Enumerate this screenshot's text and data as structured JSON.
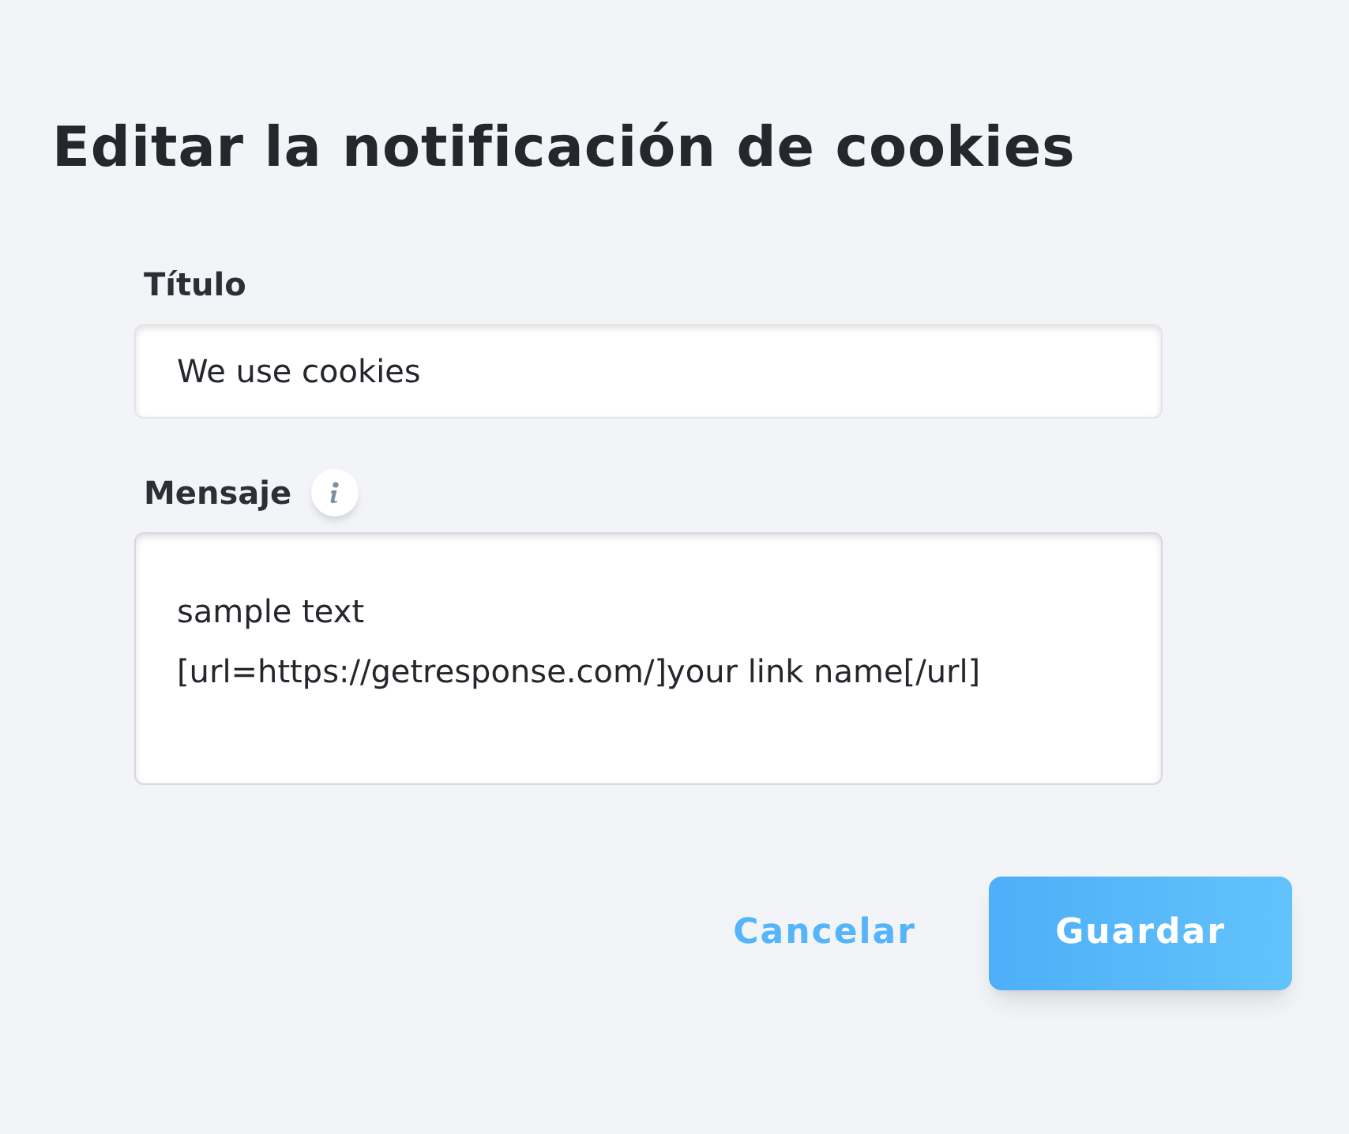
{
  "heading": "Editar la notificación de cookies",
  "fields": [
    {
      "kind": "input",
      "label": "Título",
      "value": "We use cookies",
      "info": false
    },
    {
      "kind": "textarea",
      "label": "Mensaje",
      "value": "sample text\n[url=https://getresponse.com/]your link name[/url]",
      "info": true
    }
  ],
  "buttons": [
    {
      "kind": "link",
      "label": "Cancelar"
    },
    {
      "kind": "primary",
      "label": "Guardar"
    }
  ]
}
